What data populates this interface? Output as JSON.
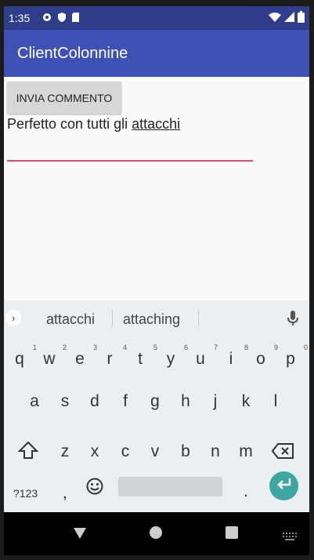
{
  "status_bar": {
    "time": "1:35",
    "left_icons": [
      "gear-icon",
      "shield-icon",
      "sd-card-icon"
    ],
    "right_icons": [
      "wifi-icon",
      "signal-icon",
      "battery-icon"
    ]
  },
  "app_bar": {
    "title": "ClientColonnine",
    "color": "#3f51b5"
  },
  "content": {
    "send_button_label": "INVIA COMMENTO",
    "comment_prefix": "Perfetto con tutti gli ",
    "comment_underlined": "attacchi",
    "underline_color": "#e0467b"
  },
  "keyboard": {
    "suggestions": [
      "attacchi",
      "attaching"
    ],
    "row1": [
      "q",
      "w",
      "e",
      "r",
      "t",
      "y",
      "u",
      "i",
      "o",
      "p"
    ],
    "row1_hints": [
      "1",
      "2",
      "3",
      "4",
      "5",
      "6",
      "7",
      "8",
      "9",
      "0"
    ],
    "row2": [
      "a",
      "s",
      "d",
      "f",
      "g",
      "h",
      "j",
      "k",
      "l"
    ],
    "row3": [
      "z",
      "x",
      "c",
      "v",
      "b",
      "n",
      "m"
    ],
    "symbols_label": "?123",
    "comma": ",",
    "period": ".",
    "enter_color": "#3da6a0"
  }
}
